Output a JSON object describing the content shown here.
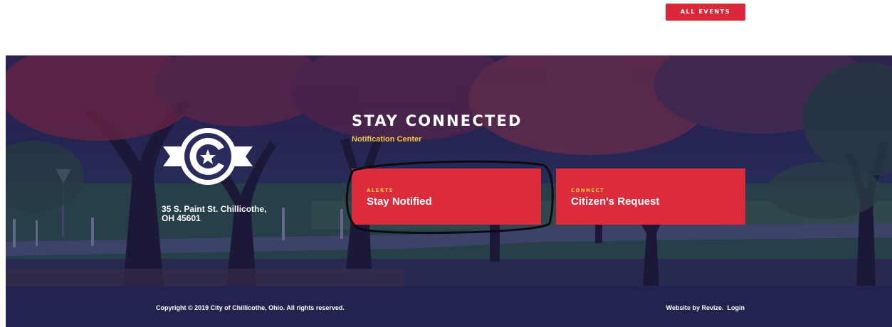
{
  "top_bar": {
    "all_events_label": "ALL EVENTS"
  },
  "hero": {
    "background_description_icon": "autumn-park-photo",
    "address_line1": "35 S. Paint St. Chillicothe,",
    "address_line2": "OH 45601",
    "title": "STAY CONNECTED",
    "subtitle": "Notification Center",
    "cards": [
      {
        "kicker": "ALERTS",
        "title": "Stay Notified"
      },
      {
        "kicker": "CONNECT",
        "title": "Citizen's Request"
      }
    ]
  },
  "footer": {
    "copyright": "Copyright © 2019 City of Chillicothe, Ohio. All rights reserved.",
    "website_by": "Website by Revize.",
    "login": "Login"
  },
  "colors": {
    "accent_red": "#dc2b3b",
    "accent_gold": "#f2c53c",
    "footer_navy": "#23234f",
    "hero_overlay": "#1c1e55"
  }
}
